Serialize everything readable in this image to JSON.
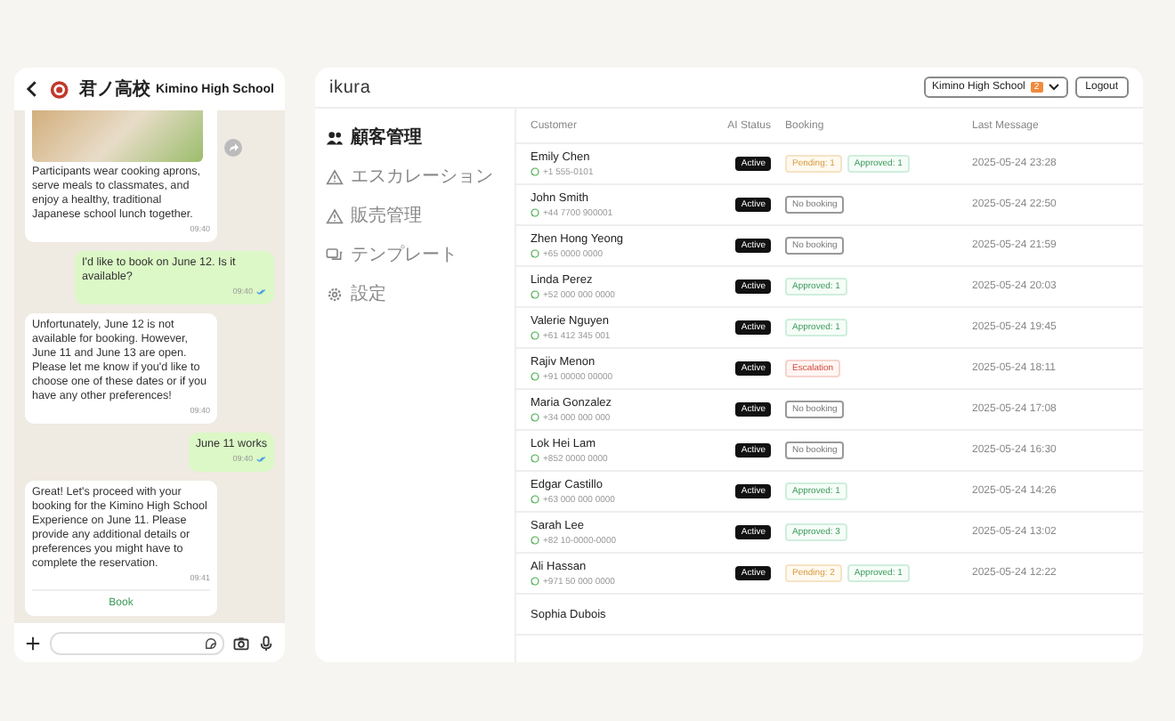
{
  "chat": {
    "title_ja": "君ノ高校",
    "title_en": "Kimino High School",
    "messages": [
      {
        "kind": "incoming",
        "photo": true,
        "text": "Participants wear cooking aprons, serve meals to classmates, and enjoy a healthy, traditional Japanese school lunch together.",
        "time": "09:40",
        "read": false
      },
      {
        "kind": "outgoing",
        "text": "I'd like to book on June 12. Is it available?",
        "time": "09:40",
        "read": true
      },
      {
        "kind": "incoming",
        "text": "Unfortunately, June 12 is not available for booking. However, June 11 and June 13 are open. Please let me know if you'd like to choose one of these dates or if you have any other preferences!",
        "time": "09:40",
        "read": false
      },
      {
        "kind": "outgoing",
        "text": "June 11 works",
        "time": "09:40",
        "read": true
      },
      {
        "kind": "incoming",
        "text": "Great! Let's proceed with your booking for the Kimino High School Experience on June 11. Please provide any additional details or preferences you might have to complete the reservation.",
        "time": "09:41",
        "read": false,
        "action": "Book"
      }
    ]
  },
  "app": {
    "logo": "ikura",
    "school_select": {
      "label": "Kimino High School",
      "badge": "2"
    },
    "logout": "Logout"
  },
  "sidebar": {
    "items": [
      {
        "label": "顧客管理",
        "selected": true
      },
      {
        "label": "エスカレーション",
        "selected": false
      },
      {
        "label": "販売管理",
        "selected": false
      },
      {
        "label": "テンプレート",
        "selected": false
      },
      {
        "label": "設定",
        "selected": false
      }
    ]
  },
  "table": {
    "columns": [
      "Customer",
      "AI Status",
      "Booking",
      "Last Message"
    ],
    "rows": [
      {
        "name": "Emily Chen",
        "phone": "+1 555-0101",
        "status": "Active",
        "booking": [
          {
            "kind": "pending",
            "label": "Pending: 1"
          },
          {
            "kind": "approved",
            "label": "Approved: 1"
          }
        ],
        "last": "2025-05-24 23:28"
      },
      {
        "name": "John Smith",
        "phone": "+44 7700 900001",
        "status": "Active",
        "booking": [
          {
            "kind": "none",
            "label": "No booking"
          }
        ],
        "last": "2025-05-24 22:50"
      },
      {
        "name": "Zhen Hong Yeong",
        "phone": "+65 0000 0000",
        "status": "Active",
        "booking": [
          {
            "kind": "none",
            "label": "No booking"
          }
        ],
        "last": "2025-05-24 21:59"
      },
      {
        "name": "Linda Perez",
        "phone": "+52 000 000 0000",
        "status": "Active",
        "booking": [
          {
            "kind": "approved",
            "label": "Approved: 1"
          }
        ],
        "last": "2025-05-24 20:03"
      },
      {
        "name": "Valerie Nguyen",
        "phone": "+61 412 345 001",
        "status": "Active",
        "booking": [
          {
            "kind": "approved",
            "label": "Approved: 1"
          }
        ],
        "last": "2025-05-24 19:45"
      },
      {
        "name": "Rajiv Menon",
        "phone": "+91 00000 00000",
        "status": "Active",
        "booking": [
          {
            "kind": "escalation",
            "label": "Escalation"
          }
        ],
        "last": "2025-05-24 18:11"
      },
      {
        "name": "Maria Gonzalez",
        "phone": "+34 000 000 000",
        "status": "Active",
        "booking": [
          {
            "kind": "none",
            "label": "No booking"
          }
        ],
        "last": "2025-05-24 17:08"
      },
      {
        "name": "Lok Hei Lam",
        "phone": "+852 0000 0000",
        "status": "Active",
        "booking": [
          {
            "kind": "none",
            "label": "No booking"
          }
        ],
        "last": "2025-05-24 16:30"
      },
      {
        "name": "Edgar Castillo",
        "phone": "+63 000 000 0000",
        "status": "Active",
        "booking": [
          {
            "kind": "approved",
            "label": "Approved: 1"
          }
        ],
        "last": "2025-05-24 14:26"
      },
      {
        "name": "Sarah Lee",
        "phone": "+82 10-0000-0000",
        "status": "Active",
        "booking": [
          {
            "kind": "approved",
            "label": "Approved: 3"
          }
        ],
        "last": "2025-05-24 13:02"
      },
      {
        "name": "Ali Hassan",
        "phone": "+971 50 000 0000",
        "status": "Active",
        "booking": [
          {
            "kind": "pending",
            "label": "Pending: 2"
          },
          {
            "kind": "approved",
            "label": "Approved: 1"
          }
        ],
        "last": "2025-05-24 12:22"
      },
      {
        "name": "Sophia Dubois"
      }
    ]
  }
}
